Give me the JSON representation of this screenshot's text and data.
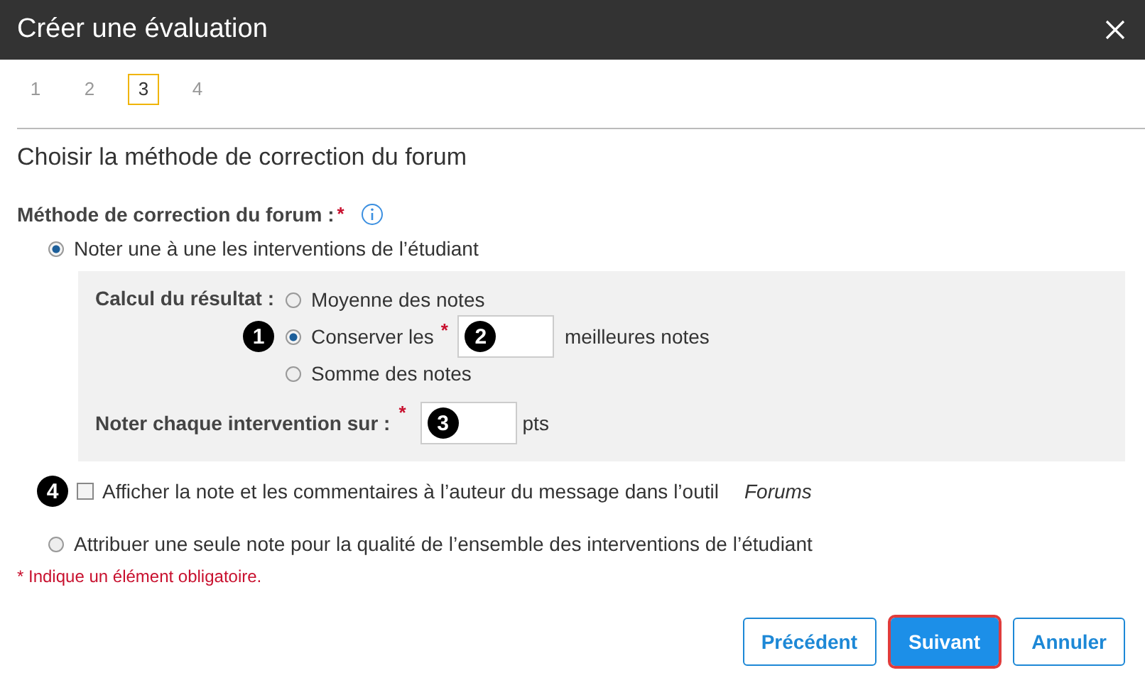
{
  "dialog": {
    "title": "Créer une évaluation"
  },
  "steps": [
    {
      "label": "1",
      "selected": false
    },
    {
      "label": "2",
      "selected": false
    },
    {
      "label": "3",
      "selected": true
    },
    {
      "label": "4",
      "selected": false
    }
  ],
  "section_title": "Choisir la méthode de correction du forum",
  "method": {
    "label": "Méthode de correction du forum :",
    "required_mark": "*"
  },
  "options": [
    {
      "label": "Noter une à une les interventions de l’étudiant",
      "selected": true
    },
    {
      "label": "Attribuer une seule note pour la qualité de l’ensemble des interventions de l’étudiant",
      "selected": false
    }
  ],
  "calculation": {
    "label": "Calcul du résultat :",
    "choices": [
      {
        "label": "Moyenne des notes",
        "selected": false
      },
      {
        "label": "Conserver les",
        "selected": true,
        "callout": "1",
        "required_mark": "*",
        "field_callout": "2",
        "suffix": "meilleures notes"
      },
      {
        "label": "Somme des notes",
        "selected": false
      }
    ]
  },
  "grade": {
    "label": "Noter chaque intervention sur :",
    "required_mark": "*",
    "field_callout": "3",
    "unit": "pts"
  },
  "show_feedback": {
    "checked": false,
    "callout": "4",
    "label": "Afficher la note et les commentaires à l’auteur du message dans l’outil",
    "tool": "Forums"
  },
  "required_note": "* Indique un élément obligatoire.",
  "buttons": [
    {
      "label": "Précédent",
      "kind": "secondary",
      "focused": false
    },
    {
      "label": "Suivant",
      "kind": "primary",
      "focused": true
    },
    {
      "label": "Annuler",
      "kind": "secondary",
      "focused": false
    }
  ]
}
